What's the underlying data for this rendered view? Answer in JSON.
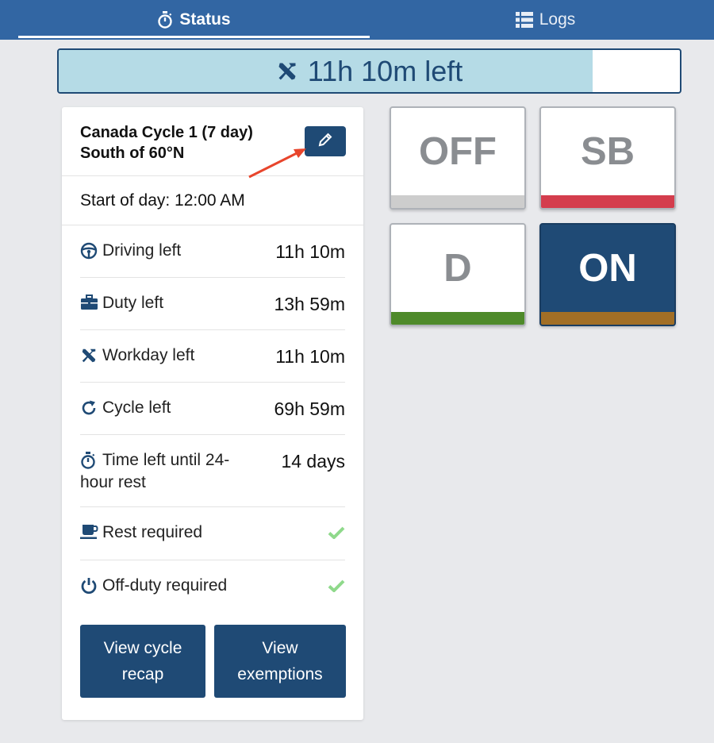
{
  "tabs": [
    {
      "label": "Status",
      "icon": "stopwatch-icon",
      "active": true
    },
    {
      "label": "Logs",
      "icon": "list-icon",
      "active": false
    }
  ],
  "progress": {
    "label": "11h 10m left",
    "icon": "tools-icon",
    "fraction": 0.86
  },
  "ruleset": {
    "title_line1": "Canada Cycle 1 (7 day)",
    "title_line2": "South of 60°N",
    "edit_icon": "pencil-icon"
  },
  "start_of_day": "Start of day: 12:00 AM",
  "stats": [
    {
      "label": "Driving left",
      "value": "11h 10m",
      "icon": "steering-wheel-icon"
    },
    {
      "label": "Duty left",
      "value": "13h 59m",
      "icon": "briefcase-icon"
    },
    {
      "label": "Workday left",
      "value": "11h 10m",
      "icon": "tools-icon"
    },
    {
      "label": "Cycle left",
      "value": "69h 59m",
      "icon": "cycle-icon"
    },
    {
      "label_line1": "Time left until 24-",
      "label_line2": "hour rest",
      "value": "14 days",
      "icon": "stopwatch-icon"
    }
  ],
  "requirements": [
    {
      "label": "Rest required",
      "icon": "coffee-icon",
      "status": "check-icon"
    },
    {
      "label": "Off-duty required",
      "icon": "power-icon",
      "status": "check-icon"
    }
  ],
  "buttons": {
    "cycle_recap_line1": "View cycle",
    "cycle_recap_line2": "recap",
    "exemptions_line1": "View",
    "exemptions_line2": "exemptions"
  },
  "duty_status": [
    {
      "label": "OFF",
      "color": "#cdcdcd",
      "active": false
    },
    {
      "label": "SB",
      "color": "#d43d4d",
      "active": false
    },
    {
      "label": "D",
      "color": "#4e8a2a",
      "active": false
    },
    {
      "label": "ON",
      "color": "#a26f26",
      "active": true
    }
  ],
  "colors": {
    "header": "#3266a3",
    "primary": "#1f4a75",
    "progress_fill": "#b5dbe6",
    "check": "#8fd98b",
    "annotation_arrow": "#e8452c"
  }
}
